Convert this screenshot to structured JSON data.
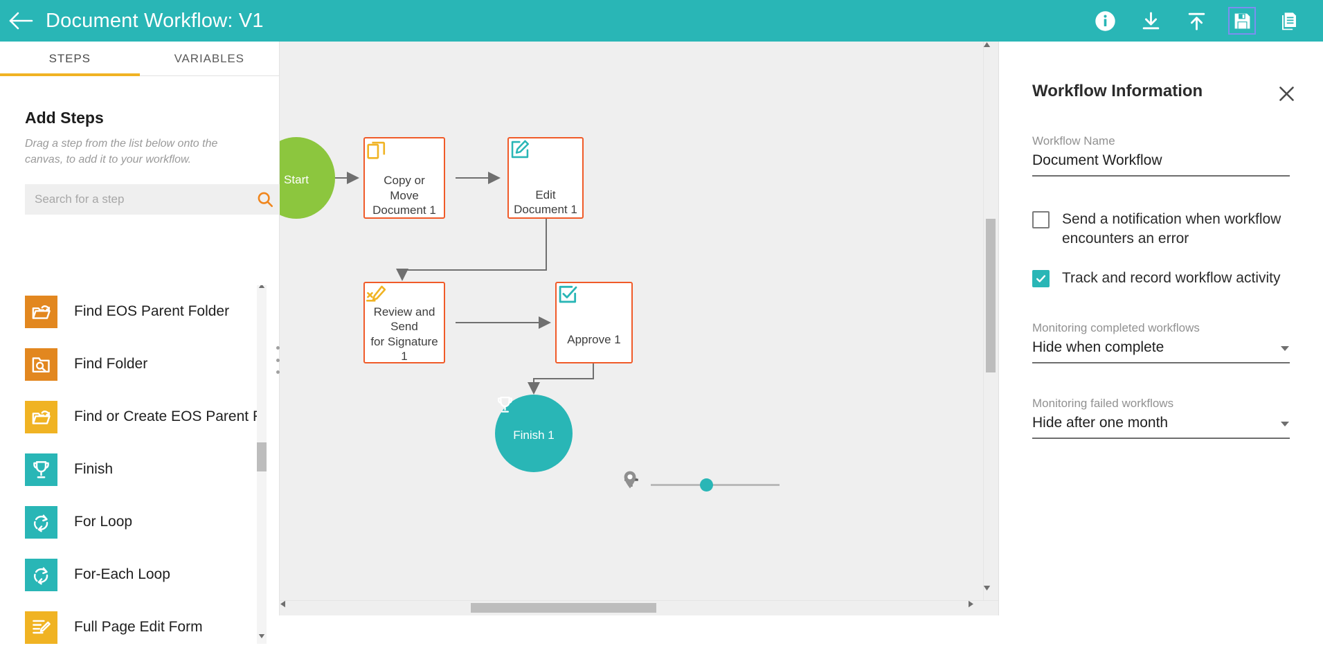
{
  "header": {
    "title": "Document Workflow: V1",
    "back_icon": "back-arrow-icon",
    "icons": [
      {
        "name": "info-icon",
        "label": "Information"
      },
      {
        "name": "download-icon",
        "label": "Download"
      },
      {
        "name": "upload-icon",
        "label": "Upload"
      },
      {
        "name": "save-icon",
        "label": "Save"
      },
      {
        "name": "copy-document-icon",
        "label": "Copy"
      }
    ],
    "accent_color": "#29b6b6"
  },
  "left_panel": {
    "tabs": [
      {
        "label": "STEPS",
        "active": true
      },
      {
        "label": "VARIABLES",
        "active": false
      }
    ],
    "tab_underline_color": "#f0b323",
    "add_steps_title": "Add Steps",
    "add_steps_sub": "Drag a step from the list below onto the canvas, to add it to your workflow.",
    "search": {
      "placeholder": "Search for a step",
      "value": ""
    },
    "steps": [
      {
        "label": "Find EOS Parent Folder",
        "icon": "folder-open-icon",
        "color": "#e2871f"
      },
      {
        "label": "Find Folder",
        "icon": "folder-search-icon",
        "color": "#e2871f"
      },
      {
        "label": "Find or Create EOS Parent F",
        "icon": "folder-open-icon",
        "color": "#f0b323"
      },
      {
        "label": "Finish",
        "icon": "trophy-icon",
        "color": "#29b6b6"
      },
      {
        "label": "For Loop",
        "icon": "loop-icon",
        "color": "#29b6b6"
      },
      {
        "label": "For-Each Loop",
        "icon": "loop-icon",
        "color": "#29b6b6"
      },
      {
        "label": "Full Page Edit Form",
        "icon": "edit-form-icon",
        "color": "#f0b323"
      }
    ]
  },
  "canvas": {
    "background": "#efefef",
    "nodes": [
      {
        "id": "start",
        "label": "Start",
        "type": "circle",
        "icon": "flag-icon",
        "color": "#8cc63e"
      },
      {
        "id": "copy_move",
        "label": "Copy or Move\nDocument 1",
        "line1": "Copy or Move",
        "line2": "Document 1",
        "type": "box",
        "icon": "copy-icon",
        "icon_color": "#f0b323"
      },
      {
        "id": "edit_doc",
        "label": "Edit Document 1",
        "line1": "Edit Document 1",
        "line2": "",
        "type": "box",
        "icon": "edit-pencil-icon",
        "icon_color": "#29b6b6"
      },
      {
        "id": "review_sign",
        "label": "Review and Send for Signature 1",
        "line1": "Review and Send",
        "line2": "for Signature 1",
        "type": "box",
        "icon": "signature-icon",
        "icon_color": "#f0b323"
      },
      {
        "id": "approve",
        "label": "Approve 1",
        "line1": "Approve 1",
        "line2": "",
        "type": "box",
        "icon": "checkbox-check-icon",
        "icon_color": "#29b6b6"
      },
      {
        "id": "finish",
        "label": "Finish 1",
        "type": "circle",
        "icon": "trophy-icon",
        "color": "#29b6b6"
      }
    ],
    "edges": [
      {
        "from": "start",
        "to": "copy_move"
      },
      {
        "from": "copy_move",
        "to": "edit_doc"
      },
      {
        "from": "edit_doc",
        "to": "review_sign"
      },
      {
        "from": "review_sign",
        "to": "approve"
      },
      {
        "from": "approve",
        "to": "finish"
      }
    ],
    "zoom_controls": {
      "minus_label": "−",
      "plus_label": "+",
      "locate_icon": "map-pin-icon",
      "slider_position_percent": 43
    }
  },
  "right_panel": {
    "title": "Workflow Information",
    "close_icon": "close-icon",
    "workflow_name": {
      "label": "Workflow Name",
      "value": "Document Workflow"
    },
    "notify_on_error": {
      "label": "Send a notification when workflow encounters an error",
      "checked": false
    },
    "track_activity": {
      "label": "Track and record workflow activity",
      "checked": true
    },
    "monitoring_completed": {
      "label": "Monitoring completed workflows",
      "value": "Hide when complete"
    },
    "monitoring_failed": {
      "label": "Monitoring failed workflows",
      "value": "Hide after one month"
    }
  }
}
